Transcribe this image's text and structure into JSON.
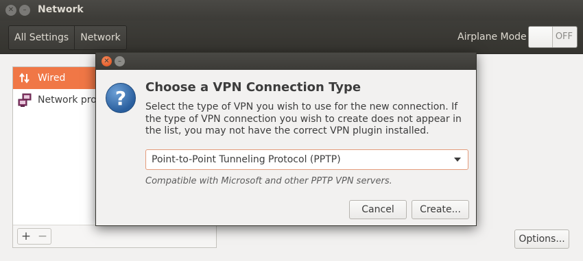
{
  "window": {
    "title": "Network"
  },
  "toolbar": {
    "breadcrumbs": [
      "All Settings",
      "Network"
    ],
    "airplane_label": "Airplane Mode",
    "airplane_state": "OFF"
  },
  "sidebar": {
    "items": [
      {
        "label": "Wired",
        "icon": "wired-network-icon",
        "selected": true
      },
      {
        "label": "Network proxy",
        "icon": "network-proxy-icon",
        "selected": false
      }
    ],
    "add_label": "+",
    "remove_label": "−"
  },
  "main": {
    "options_label": "Options..."
  },
  "dialog": {
    "heading": "Choose a VPN Connection Type",
    "body": "Select the type of VPN you wish to use for the new connection.  If the type of VPN connection you wish to create does not appear in the list, you may not have the correct VPN plugin installed.",
    "icon": "question-icon",
    "select_value": "Point-to-Point Tunneling Protocol (PPTP)",
    "note": "Compatible with Microsoft and other PPTP VPN servers.",
    "cancel_label": "Cancel",
    "create_label": "Create..."
  },
  "colors": {
    "accent": "#f07746",
    "titlebar": "#3c3b37",
    "window_bg": "#f2f1f0"
  }
}
